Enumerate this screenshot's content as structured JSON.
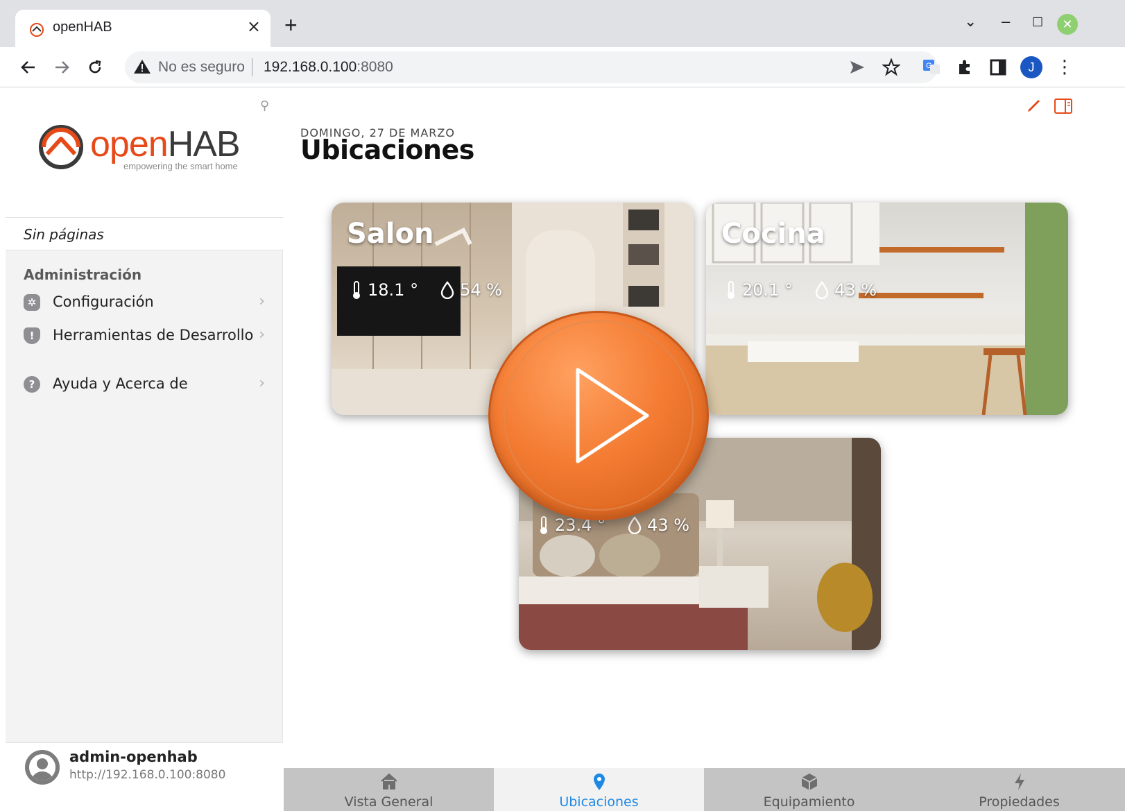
{
  "browser": {
    "tab_title": "openHAB",
    "new_tab": "+",
    "security_label": "No es seguro",
    "url_host": "192.168.0.100",
    "url_port": ":8080",
    "profile_initial": "J"
  },
  "sidebar": {
    "logo_open": "open",
    "logo_hab": "HAB",
    "logo_tagline": "empowering the smart home",
    "no_pages": "Sin páginas",
    "admin_heading": "Administración",
    "items": [
      {
        "label": "Configuración",
        "icon": "gear-icon"
      },
      {
        "label": "Herramientas de Desarrollo",
        "icon": "shield-icon"
      },
      {
        "label": "Ayuda y Acerca de",
        "icon": "help-icon"
      }
    ],
    "user": {
      "name": "admin-openhab",
      "url": "http://192.168.0.100:8080"
    }
  },
  "main": {
    "date": "DOMINGO, 27 DE MARZO",
    "title": "Ubicaciones",
    "cards": [
      {
        "name": "Salon",
        "temperature": "18.1 °",
        "humidity": "54 %"
      },
      {
        "name": "Cocina",
        "temperature": "20.1 °",
        "humidity": "43 %"
      },
      {
        "name": "",
        "temperature": "23.4 °",
        "humidity": "43 %"
      }
    ]
  },
  "bottom_tabs": [
    {
      "label": "Vista General",
      "icon": "home-icon",
      "active": false
    },
    {
      "label": "Ubicaciones",
      "icon": "location-pin-icon",
      "active": true
    },
    {
      "label": "Equipamiento",
      "icon": "cube-icon",
      "active": false
    },
    {
      "label": "Propiedades",
      "icon": "lightning-icon",
      "active": false
    }
  ],
  "colors": {
    "brand_orange": "#e64a19",
    "accent_blue": "#1e88e5"
  }
}
